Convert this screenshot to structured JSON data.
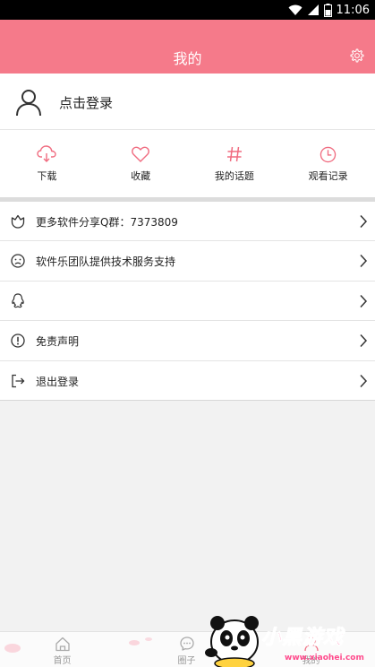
{
  "status_bar": {
    "time": "11:06"
  },
  "header": {
    "title": "我的"
  },
  "login": {
    "label": "点击登录"
  },
  "quick_actions": [
    {
      "label": "下载",
      "icon": "cloud-download-icon"
    },
    {
      "label": "收藏",
      "icon": "heart-icon"
    },
    {
      "label": "我的话题",
      "icon": "hash-icon"
    },
    {
      "label": "观看记录",
      "icon": "clock-icon"
    }
  ],
  "menu": [
    {
      "label": "更多软件分享Q群：7373809",
      "icon": "flower-icon"
    },
    {
      "label": "软件乐团队提供技术服务支持",
      "icon": "sad-face-icon"
    },
    {
      "label": "",
      "icon": "qq-icon"
    },
    {
      "label": "免责声明",
      "icon": "exclamation-icon"
    },
    {
      "label": "退出登录",
      "icon": "logout-icon"
    }
  ],
  "bottom_nav": [
    {
      "label": "首页",
      "icon": "home-icon"
    },
    {
      "label": "圈子",
      "icon": "chat-icon"
    },
    {
      "label": "我的",
      "icon": "user-icon"
    }
  ],
  "watermark": {
    "brand": "小黑游戏",
    "url": "www.xiaohei.com"
  },
  "colors": {
    "accent": "#f57a8a",
    "icon_pink": "#f06c80",
    "background": "#f2f2f2"
  }
}
